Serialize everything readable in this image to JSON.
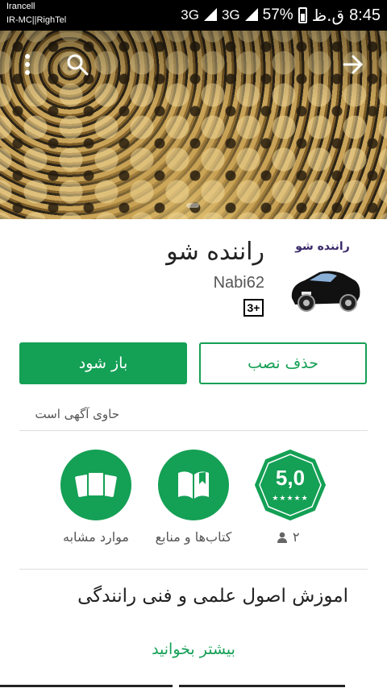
{
  "status_bar": {
    "carrier_line1": "Irancell",
    "carrier_line2": "IR-MC||RighTel",
    "network": "3G",
    "battery_percent": "57%",
    "time_suffix": "ق.ظ",
    "time": "8:45"
  },
  "app": {
    "title": "راننده شو",
    "developer": "Nabi62",
    "content_rating": "3+",
    "icon_caption": "راننده شو"
  },
  "actions": {
    "open_label": "باز شود",
    "uninstall_label": "حذف نصب"
  },
  "ads_notice": "حاوی آگهی است",
  "badges": {
    "rating_value": "5,0",
    "rating_stars": "★★★★★",
    "review_count": "۲",
    "books_label": "کتاب‌ها و منابع",
    "similar_label": "موارد مشابه"
  },
  "description": "اموزش اصول علمی و فنی رانندگی",
  "read_more": "بیشتر بخوانید",
  "colors": {
    "accent": "#14a055",
    "status_bar": "#000000"
  },
  "icons": [
    "more-vert-icon",
    "search-icon",
    "arrow-forward-icon",
    "cards-icon",
    "book-icon",
    "person-icon"
  ]
}
